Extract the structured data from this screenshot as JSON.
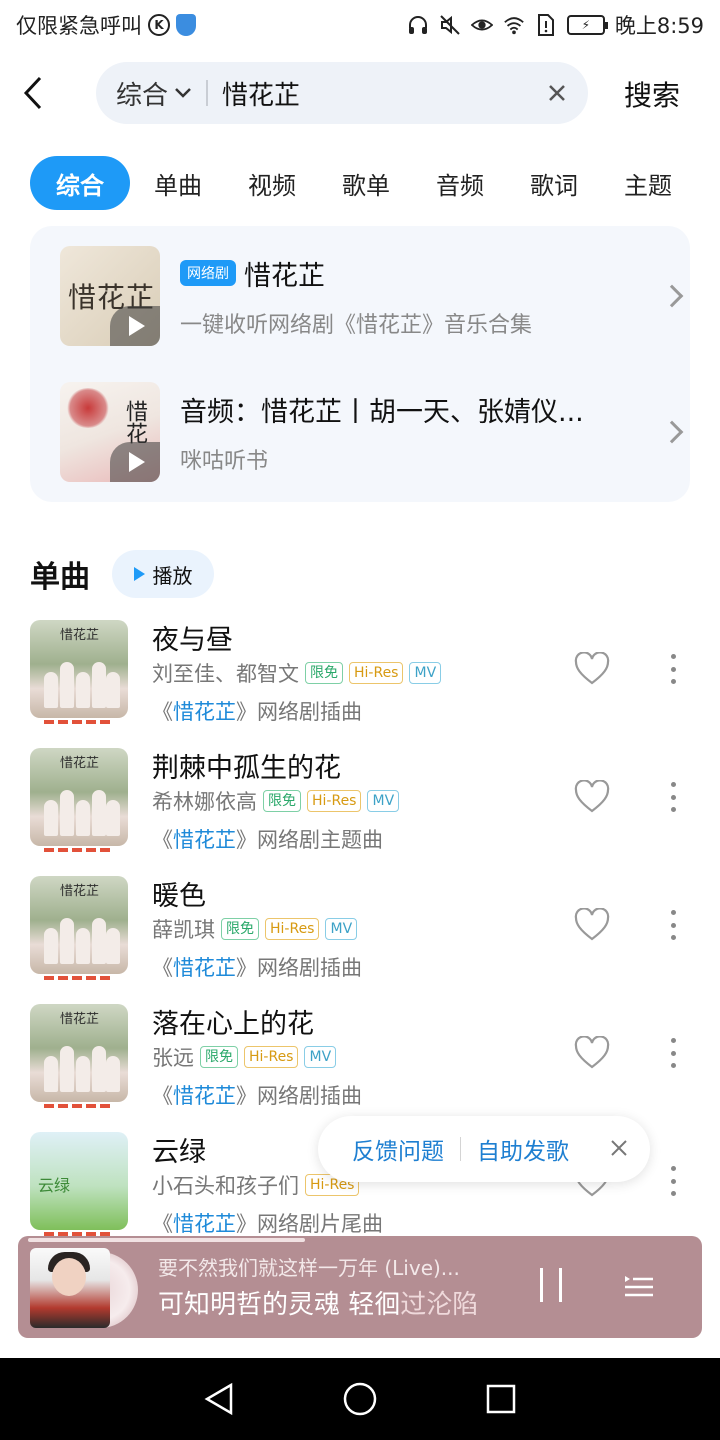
{
  "status": {
    "carrier": "仅限紧急呼叫",
    "k_badge": "K",
    "time": "晚上8:59",
    "icons": [
      "headphone-icon",
      "mute-icon",
      "eye-icon",
      "wifi-icon",
      "sim-alert-icon",
      "battery-charging-icon"
    ]
  },
  "search": {
    "category": "综合",
    "query": "惜花芷",
    "button": "搜索"
  },
  "tabs": [
    "综合",
    "单曲",
    "视频",
    "歌单",
    "音频",
    "歌词",
    "主题"
  ],
  "top_results": [
    {
      "tag": "网络剧",
      "title": "惜花芷",
      "subtitle": "一键收听网络剧《惜花芷》音乐合集",
      "cover_text": "惜花芷"
    },
    {
      "tag": "",
      "title": "音频：惜花芷丨胡一天、张婧仪...",
      "subtitle": "咪咕听书",
      "cover_text": "惜花"
    }
  ],
  "songs_section": {
    "title": "单曲",
    "play_label": "播放"
  },
  "songs": [
    {
      "title": "夜与昼",
      "artist": "刘至佳、都智文",
      "badges": [
        "限免",
        "Hi-Res",
        "MV"
      ],
      "album_prefix": "《",
      "album": "惜花芷",
      "album_suffix": "》网络剧插曲",
      "cover": "惜花芷"
    },
    {
      "title": "荆棘中孤生的花",
      "artist": "希林娜依高",
      "badges": [
        "限免",
        "Hi-Res",
        "MV"
      ],
      "album_prefix": "《",
      "album": "惜花芷",
      "album_suffix": "》网络剧主题曲",
      "cover": "惜花芷"
    },
    {
      "title": "暖色",
      "artist": "薛凯琪",
      "badges": [
        "限免",
        "Hi-Res",
        "MV"
      ],
      "album_prefix": "《",
      "album": "惜花芷",
      "album_suffix": "》网络剧插曲",
      "cover": "惜花芷"
    },
    {
      "title": "落在心上的花",
      "artist": "张远",
      "badges": [
        "限免",
        "Hi-Res",
        "MV"
      ],
      "album_prefix": "《",
      "album": "惜花芷",
      "album_suffix": "》网络剧插曲",
      "cover": "惜花芷"
    },
    {
      "title": "云绿",
      "artist": "小石头和孩子们",
      "badges": [
        "Hi-Res"
      ],
      "album_prefix": "《",
      "album": "惜花芷",
      "album_suffix": "》网络剧片尾曲",
      "cover": "云绿"
    }
  ],
  "feedback": {
    "report": "反馈问题",
    "publish": "自助发歌"
  },
  "player": {
    "song_line": "要不然我们就这样一万年 (Live)...",
    "lyric_bright": "可知明哲的灵魂 轻徊",
    "lyric_dim": "过沦陷",
    "progress": 0.42
  },
  "colors": {
    "accent": "#1e9af7",
    "player_bg": "#b48e93",
    "free_badge": "#2aa86a",
    "hires_badge": "#d79a12",
    "mv_badge": "#3da2c7"
  }
}
